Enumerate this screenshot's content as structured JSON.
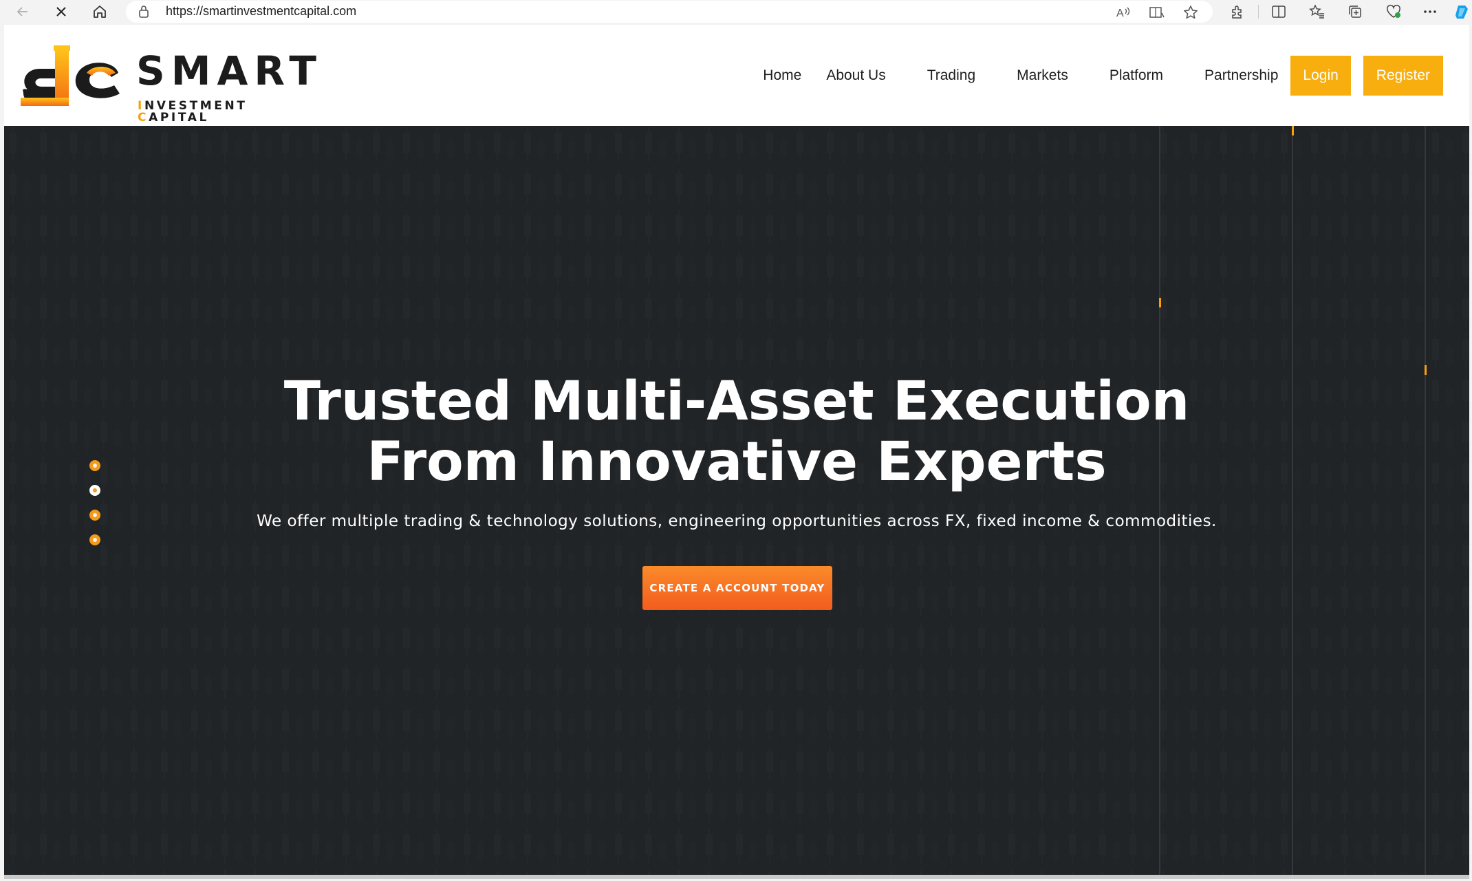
{
  "browser": {
    "url": "https://smartinvestmentcapital.com",
    "icons": [
      "back-icon",
      "stop-icon",
      "home-icon",
      "lock-icon",
      "read-aloud-icon",
      "immersive-reader-icon",
      "favorite-star-icon",
      "extensions-icon",
      "split-screen-icon",
      "favorites-icon",
      "collections-icon",
      "browser-essentials-icon",
      "more-options-icon",
      "copilot-icon"
    ]
  },
  "header": {
    "logo": {
      "title": "SMART",
      "subtitle_parts": [
        {
          "text": "I",
          "accent": true
        },
        {
          "text": "NVESTMENT ",
          "accent": false
        },
        {
          "text": "C",
          "accent": true
        },
        {
          "text": "APITAL",
          "accent": false
        }
      ]
    },
    "nav": {
      "home": "Home",
      "about": "About Us",
      "trading": "Trading",
      "markets": "Markets",
      "platform": "Platform",
      "partnership": "Partnership",
      "login": "Login",
      "register": "Register"
    }
  },
  "hero": {
    "title_line1": "Trusted Multi-Asset Execution",
    "title_line2": "From Innovative Experts",
    "subtitle": "We offer multiple trading & technology solutions, engineering opportunities across FX, fixed income & commodities.",
    "cta": "CREATE A ACCOUNT TODAY",
    "slider": {
      "count": 4,
      "active_index": 1
    }
  },
  "colors": {
    "accent": "#f8ae0e",
    "cta_gradient": [
      "#fb8b2a",
      "#f25c1e"
    ],
    "hero_bg": "#212427",
    "text_dark": "#1e1e1e"
  }
}
